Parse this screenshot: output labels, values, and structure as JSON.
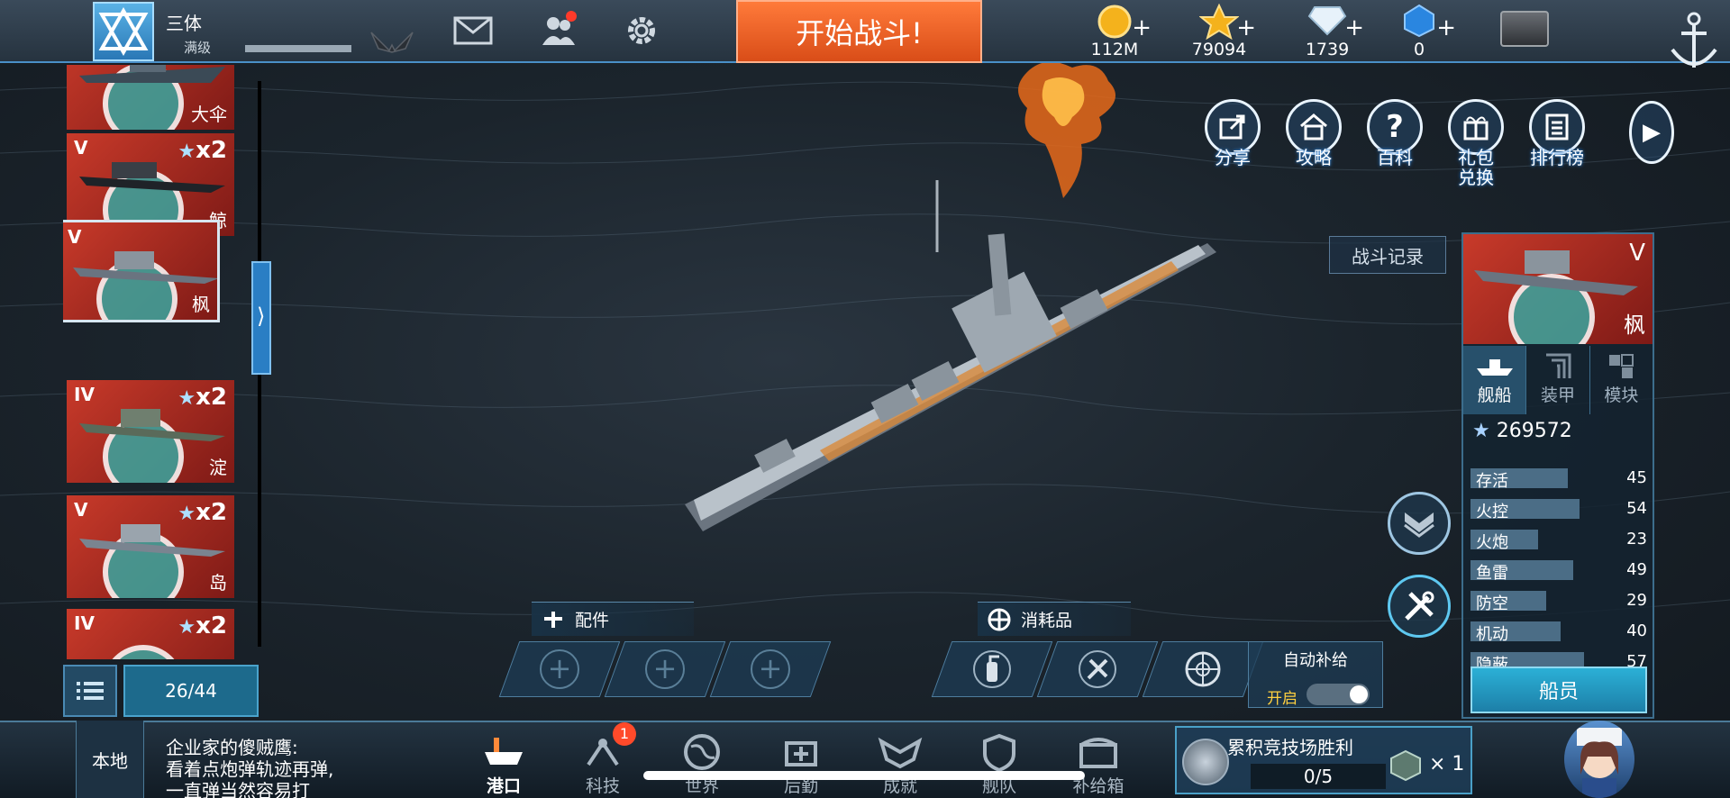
{
  "header": {
    "player_name": "三体",
    "player_level": "满级",
    "start_battle_label": "开始战斗!",
    "resources": [
      {
        "icon": "gold-coin-icon",
        "value": "112M"
      },
      {
        "icon": "gold-star-icon",
        "value": "79094"
      },
      {
        "icon": "diamond-icon",
        "value": "1739"
      },
      {
        "icon": "blue-gem-icon",
        "value": "0"
      }
    ]
  },
  "ship_list": {
    "cards": [
      {
        "tier": "",
        "count": "",
        "name": "大伞"
      },
      {
        "tier": "V",
        "count": "x2",
        "name": "鲸"
      },
      {
        "tier": "V",
        "count": "",
        "name": "枫"
      },
      {
        "tier": "IV",
        "count": "x2",
        "name": "淀"
      },
      {
        "tier": "V",
        "count": "x2",
        "name": "岛"
      },
      {
        "tier": "IV",
        "count": "x2",
        "name": ""
      }
    ],
    "count_label": "26/44"
  },
  "quick_menu": [
    {
      "label": "分享",
      "icon": "share-icon"
    },
    {
      "label": "攻略",
      "icon": "home-guide-icon"
    },
    {
      "label": "百科",
      "icon": "question-icon"
    },
    {
      "label": "礼包\n兑换",
      "icon": "gift-icon"
    },
    {
      "label": "排行榜",
      "icon": "leaderboard-icon"
    }
  ],
  "battle_record_label": "战斗记录",
  "info_panel": {
    "tier": "V",
    "ship_name": "枫",
    "tabs": [
      "舰船",
      "装甲",
      "模块"
    ],
    "power": "269572",
    "stats": [
      {
        "label": "存活",
        "value": 45
      },
      {
        "label": "火控",
        "value": 54
      },
      {
        "label": "火炮",
        "value": 23
      },
      {
        "label": "鱼雷",
        "value": 49
      },
      {
        "label": "防空",
        "value": 29
      },
      {
        "label": "机动",
        "value": 40
      },
      {
        "label": "隐蔽",
        "value": 57
      }
    ],
    "crew_label": "船员"
  },
  "parts": {
    "title": "配件"
  },
  "consumables": {
    "title": "消耗品",
    "auto_supply": "自动补给",
    "auto_on": "开启"
  },
  "bottom": {
    "local_label": "本地",
    "chat_message": "企业家的傻贼鹰:\n看着点炮弹轨迹再弹,\n一直弹当然容易打",
    "nav": [
      {
        "label": "港口",
        "icon": "port-icon",
        "badge": ""
      },
      {
        "label": "科技",
        "icon": "tech-icon",
        "badge": "1"
      },
      {
        "label": "世界",
        "icon": "world-icon",
        "badge": ""
      },
      {
        "label": "后勤",
        "icon": "logistics-icon",
        "badge": ""
      },
      {
        "label": "成就",
        "icon": "achievement-icon",
        "badge": ""
      },
      {
        "label": "舰队",
        "icon": "fleet-icon",
        "badge": ""
      },
      {
        "label": "补给箱",
        "icon": "supply-box-icon",
        "badge": ""
      }
    ],
    "arena": {
      "title": "累积竞技场胜利",
      "progress": "0/5",
      "multiplier": "× 1"
    }
  }
}
